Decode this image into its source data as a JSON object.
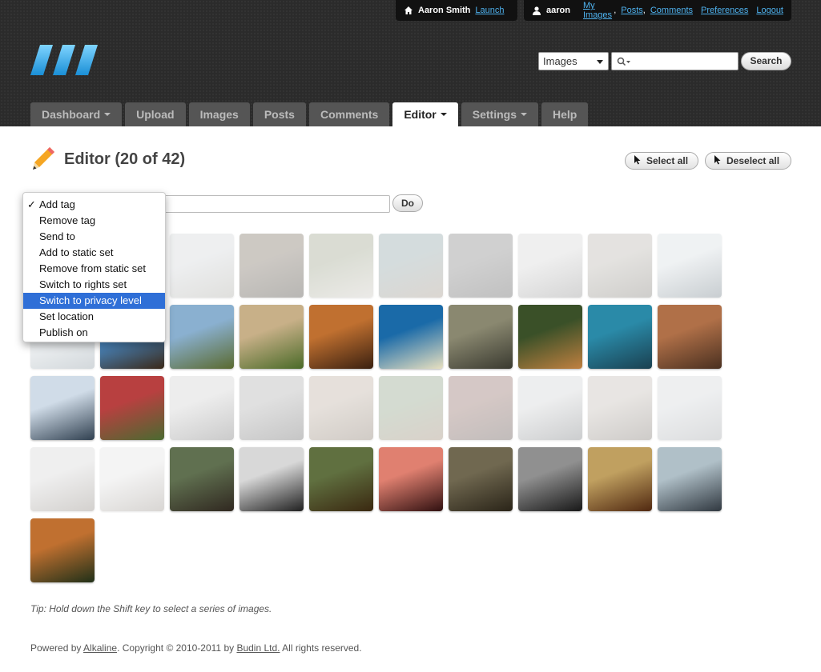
{
  "topbar": {
    "site_user": "Aaron Smith",
    "launch": "Launch",
    "username": "aaron",
    "my_images": "My Images",
    "sep1": ",",
    "posts": "Posts",
    "sep2": ",",
    "comments": "Comments",
    "preferences": "Preferences",
    "logout": "Logout"
  },
  "search": {
    "scope": "Images",
    "button": "Search"
  },
  "tabs": [
    {
      "label": "Dashboard",
      "has_caret": true
    },
    {
      "label": "Upload",
      "has_caret": false
    },
    {
      "label": "Images",
      "has_caret": false
    },
    {
      "label": "Posts",
      "has_caret": false
    },
    {
      "label": "Comments",
      "has_caret": false
    },
    {
      "label": "Editor",
      "has_caret": true,
      "active": true
    },
    {
      "label": "Settings",
      "has_caret": true
    },
    {
      "label": "Help",
      "has_caret": false
    }
  ],
  "page": {
    "title": "Editor (20 of 42)",
    "select_all": "Select all",
    "deselect_all": "Deselect all",
    "do_button": "Do"
  },
  "action_menu": {
    "checkmark": "✓",
    "items": [
      "Add tag",
      "Remove tag",
      "Send to",
      "Add to static set",
      "Remove from static set",
      "Switch to rights set",
      "Switch to privacy level",
      "Set location",
      "Publish on"
    ],
    "selected_index": 0,
    "highlighted_index": 6
  },
  "thumbnails": [
    {
      "selected": false,
      "colors": [
        "#b8b8b8",
        "#606060"
      ]
    },
    {
      "selected": false,
      "colors": [
        "#8a8a8a",
        "#3a3a3a"
      ]
    },
    {
      "selected": false,
      "colors": [
        "#c8d0d8",
        "#a0a090"
      ]
    },
    {
      "selected": false,
      "colors": [
        "#705838",
        "#2a2010"
      ]
    },
    {
      "selected": false,
      "colors": [
        "#8a9a60",
        "#c8c0b0"
      ]
    },
    {
      "selected": false,
      "colors": [
        "#6a9aa0",
        "#a08060"
      ]
    },
    {
      "selected": false,
      "colors": [
        "#707070",
        "#404040"
      ]
    },
    {
      "selected": false,
      "colors": [
        "#d0d0d0",
        "#808080"
      ]
    },
    {
      "selected": false,
      "colors": [
        "#b0a898",
        "#706858"
      ]
    },
    {
      "selected": false,
      "colors": [
        "#c8d8e0",
        "#4a6a80"
      ]
    },
    {
      "selected": false,
      "colors": [
        "#d0e0e8",
        "#6a8aa0"
      ]
    },
    {
      "selected": true,
      "colors": [
        "#4a90d0",
        "#3a2818"
      ]
    },
    {
      "selected": true,
      "colors": [
        "#8ab0d0",
        "#5a6a30"
      ]
    },
    {
      "selected": true,
      "colors": [
        "#c8b088",
        "#4a6a28"
      ]
    },
    {
      "selected": true,
      "colors": [
        "#c07030",
        "#3a2010"
      ]
    },
    {
      "selected": true,
      "colors": [
        "#1a6aa8",
        "#e8e0c0"
      ]
    },
    {
      "selected": true,
      "colors": [
        "#8a8870",
        "#3a3a30"
      ]
    },
    {
      "selected": true,
      "colors": [
        "#3a5028",
        "#c08040"
      ]
    },
    {
      "selected": true,
      "colors": [
        "#2a8aa8",
        "#1a4050"
      ]
    },
    {
      "selected": true,
      "colors": [
        "#b07048",
        "#4a3020"
      ]
    },
    {
      "selected": true,
      "colors": [
        "#d0dce8",
        "#304050"
      ]
    },
    {
      "selected": true,
      "colors": [
        "#b84040",
        "#4a6a30"
      ]
    },
    {
      "selected": false,
      "colors": [
        "#c8c8c8",
        "#606060"
      ]
    },
    {
      "selected": false,
      "colors": [
        "#a0a0a0",
        "#505050"
      ]
    },
    {
      "selected": false,
      "colors": [
        "#c0a080",
        "#806040"
      ]
    },
    {
      "selected": false,
      "colors": [
        "#6a9a5a",
        "#a07040"
      ]
    },
    {
      "selected": false,
      "colors": [
        "#a05040",
        "#503028"
      ]
    },
    {
      "selected": false,
      "colors": [
        "#c8ccd0",
        "#606870"
      ]
    },
    {
      "selected": false,
      "colors": [
        "#c0b0a0",
        "#706050"
      ]
    },
    {
      "selected": false,
      "colors": [
        "#c8d0d8",
        "#9098a0"
      ]
    },
    {
      "selected": false,
      "colors": [
        "#d0d0d0",
        "#807060"
      ]
    },
    {
      "selected": false,
      "colors": [
        "#e0e0e0",
        "#908070"
      ]
    },
    {
      "selected": true,
      "colors": [
        "#607050",
        "#302820"
      ]
    },
    {
      "selected": true,
      "colors": [
        "#d8d8d8",
        "#202020"
      ]
    },
    {
      "selected": true,
      "colors": [
        "#607040",
        "#3a2810"
      ]
    },
    {
      "selected": true,
      "colors": [
        "#e08070",
        "#301010"
      ]
    },
    {
      "selected": true,
      "colors": [
        "#706850",
        "#2a2418"
      ]
    },
    {
      "selected": true,
      "colors": [
        "#909090",
        "#181818"
      ]
    },
    {
      "selected": true,
      "colors": [
        "#c0a060",
        "#502810"
      ]
    },
    {
      "selected": true,
      "colors": [
        "#b0c0c8",
        "#303840"
      ]
    },
    {
      "selected": true,
      "colors": [
        "#c07030",
        "#203018"
      ]
    }
  ],
  "tip": "Tip: Hold down the Shift key to select a series of images.",
  "footer": {
    "powered_by": "Powered by ",
    "alkaline": "Alkaline",
    "copyright": ". Copyright © 2010-2011 by ",
    "budin": "Budin Ltd.",
    "rights": " All rights reserved."
  }
}
